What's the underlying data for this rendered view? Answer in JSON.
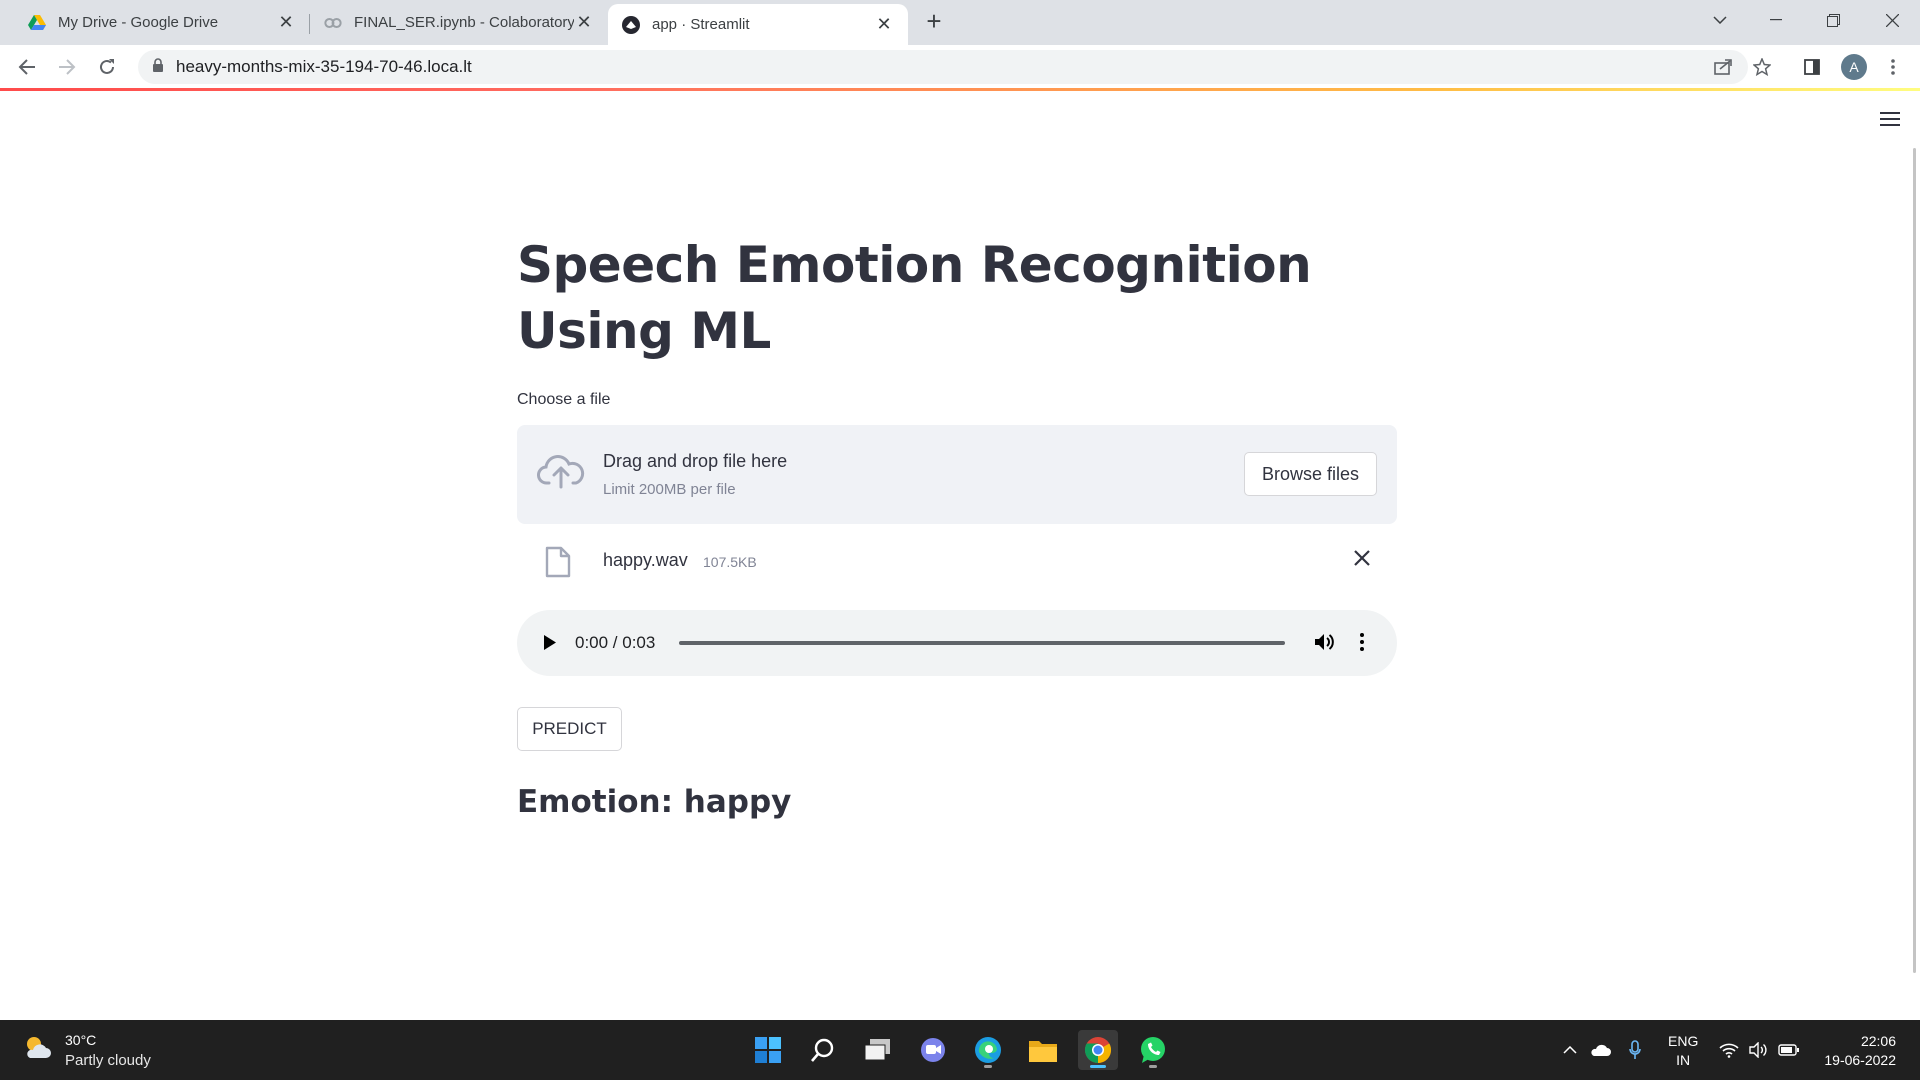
{
  "browser": {
    "tabs": [
      {
        "title": "My Drive - Google Drive",
        "close": "✕"
      },
      {
        "title": "FINAL_SER.ipynb - Colaboratory",
        "close": "✕"
      },
      {
        "title": "app · Streamlit",
        "close": "✕"
      }
    ],
    "new_tab": "+",
    "url": "heavy-months-mix-35-194-70-46.loca.lt",
    "profile_initial": "A"
  },
  "page": {
    "title": "Speech Emotion Recognition Using ML",
    "uploader": {
      "label": "Choose a file",
      "drop_text": "Drag and drop file here",
      "limit_text": "Limit 200MB per file",
      "browse_label": "Browse files"
    },
    "file": {
      "name": "happy.wav",
      "size": "107.5KB"
    },
    "audio": {
      "time": "0:00 / 0:03",
      "progress": 0
    },
    "predict_label": "PREDICT",
    "result": "Emotion: happy"
  },
  "taskbar": {
    "weather": {
      "temp": "30°C",
      "desc": "Partly cloudy"
    },
    "lang_line1": "ENG",
    "lang_line2": "IN",
    "time": "22:06",
    "date": "19-06-2022"
  },
  "colors": {
    "accent_stripe_start": "#ff4b4b",
    "accent_stripe_end": "#fffd80",
    "text": "#31333f",
    "dropzone_bg": "#f0f2f6"
  }
}
